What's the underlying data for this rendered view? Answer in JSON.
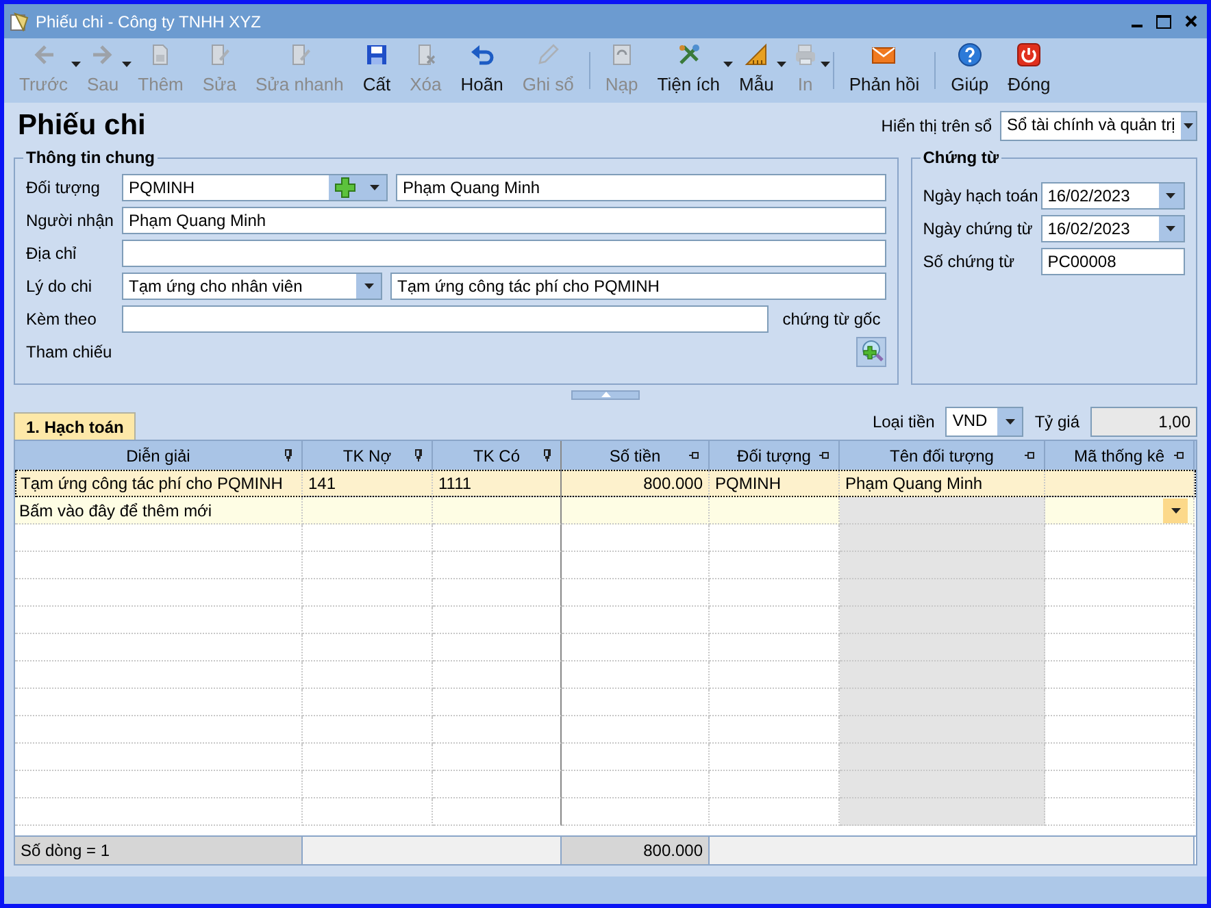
{
  "window": {
    "title": "Phiếu chi - Công ty TNHH XYZ"
  },
  "toolbar": [
    {
      "kind": "button",
      "label": "Trước",
      "disabled": true,
      "dropdown": true
    },
    {
      "kind": "button",
      "label": "Sau",
      "disabled": true,
      "dropdown": true
    },
    {
      "kind": "button",
      "label": "Thêm",
      "disabled": true,
      "dropdown": false
    },
    {
      "kind": "button",
      "label": "Sửa",
      "disabled": true,
      "dropdown": false
    },
    {
      "kind": "button",
      "label": "Sửa nhanh",
      "disabled": true,
      "dropdown": false
    },
    {
      "kind": "button",
      "label": "Cất",
      "disabled": false,
      "dropdown": false
    },
    {
      "kind": "button",
      "label": "Xóa",
      "disabled": true,
      "dropdown": false
    },
    {
      "kind": "button",
      "label": "Hoãn",
      "disabled": false,
      "dropdown": false
    },
    {
      "kind": "button",
      "label": "Ghi sổ",
      "disabled": true,
      "dropdown": false
    },
    {
      "kind": "separator"
    },
    {
      "kind": "button",
      "label": "Nạp",
      "disabled": true,
      "dropdown": false
    },
    {
      "kind": "button",
      "label": "Tiện ích",
      "disabled": false,
      "dropdown": true
    },
    {
      "kind": "button",
      "label": "Mẫu",
      "disabled": false,
      "dropdown": true
    },
    {
      "kind": "button",
      "label": "In",
      "disabled": true,
      "dropdown": true
    },
    {
      "kind": "separator"
    },
    {
      "kind": "button",
      "label": "Phản hồi",
      "disabled": false,
      "dropdown": false
    },
    {
      "kind": "separator"
    },
    {
      "kind": "button",
      "label": "Giúp",
      "disabled": false,
      "dropdown": false
    },
    {
      "kind": "button",
      "label": "Đóng",
      "disabled": false,
      "dropdown": false
    }
  ],
  "form_title": "Phiếu chi",
  "ledger": {
    "label": "Hiển thị trên sổ",
    "value": "Sổ tài chính và quản trị"
  },
  "general": {
    "title": "Thông tin chung",
    "fields": [
      {
        "kind": "lookup",
        "label": "Đối tượng",
        "value": "PQMINH",
        "detail": "Phạm Quang Minh"
      },
      {
        "kind": "text",
        "label": "Người nhận",
        "value": "Phạm Quang Minh"
      },
      {
        "kind": "text",
        "label": "Địa chỉ"
      },
      {
        "kind": "combo",
        "label": "Lý do chi",
        "value": "Tạm ứng cho nhân viên",
        "detail": "Tạm ứng công tác phí cho PQMINH"
      },
      {
        "kind": "suffix",
        "label": "Kèm theo",
        "suffix": "chứng từ gốc"
      },
      {
        "kind": "reference",
        "label": "Tham chiếu"
      }
    ]
  },
  "voucher": {
    "title": "Chứng từ",
    "fields": [
      {
        "kind": "date",
        "label": "Ngày hạch toán",
        "value": "16/02/2023"
      },
      {
        "kind": "date",
        "label": "Ngày chứng từ",
        "value": "16/02/2023"
      },
      {
        "kind": "text",
        "label": "Số chứng từ",
        "value": "PC00008"
      }
    ]
  },
  "tabs": [
    {
      "label": "1. Hạch toán",
      "selected": true
    }
  ],
  "currency": {
    "label": "Loại tiền",
    "value": "VND"
  },
  "rate": {
    "label": "Tỷ giá",
    "value": "1,00"
  },
  "grid": {
    "columns": [
      {
        "label": "Diễn giải",
        "readonly": false
      },
      {
        "label": "TK Nợ",
        "readonly": false
      },
      {
        "label": "TK Có",
        "readonly": false
      },
      {
        "label": "Số tiền",
        "readonly": false
      },
      {
        "label": "Đối tượng",
        "readonly": false
      },
      {
        "label": "Tên đối tượng",
        "readonly": true
      },
      {
        "label": "Mã thống kê",
        "readonly": false
      }
    ],
    "rows": [
      {
        "selected": true,
        "cells": [
          "Tạm ứng công tác phí cho PQMINH",
          "141",
          "1111",
          "800.000",
          "PQMINH",
          "Phạm Quang Minh"
        ]
      }
    ],
    "new_row_hint": "Bấm vào đây để thêm mới",
    "footer": {
      "count": "Số dòng = 1",
      "total": "800.000"
    }
  }
}
